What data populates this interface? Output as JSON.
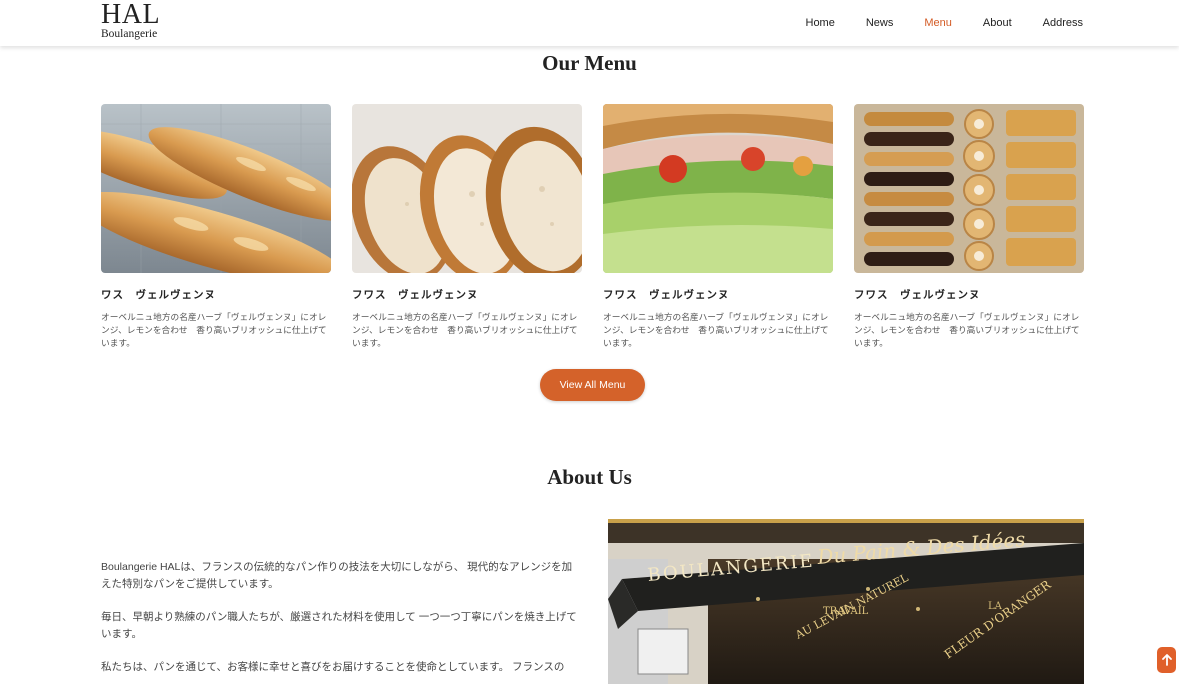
{
  "header": {
    "logo_main": "HAL",
    "logo_sub": "Boulangerie",
    "nav": [
      {
        "label": "Home"
      },
      {
        "label": "News"
      },
      {
        "label": "Menu"
      },
      {
        "label": "About"
      },
      {
        "label": "Address"
      }
    ],
    "active_nav": "Menu"
  },
  "menu": {
    "title": "Our Menu",
    "items": [
      {
        "name": "ワス　ヴェルヴェンヌ",
        "description": "オーベルニュ地方の名産ハーブ「ヴェルヴェンヌ」にオレンジ、レモンを合わせ　香り高いブリオッシュに仕上げています。",
        "image": "baguettes"
      },
      {
        "name": "フワス　ヴェルヴェンヌ",
        "description": "オーベルニュ地方の名産ハーブ「ヴェルヴェンヌ」にオレンジ、レモンを合わせ　香り高いブリオッシュに仕上げています。",
        "image": "sliced-bread"
      },
      {
        "name": "フワス　ヴェルヴェンヌ",
        "description": "オーベルニュ地方の名産ハーブ「ヴェルヴェンヌ」にオレンジ、レモンを合わせ　香り高いブリオッシュに仕上げています。",
        "image": "sandwich"
      },
      {
        "name": "フワス　ヴェルヴェンヌ",
        "description": "オーベルニュ地方の名産ハーブ「ヴェルヴェンヌ」にオレンジ、レモンを合わせ　香り高いブリオッシュに仕上げています。",
        "image": "pastries"
      }
    ],
    "button_label": "View All Menu"
  },
  "about": {
    "title": "About Us",
    "paragraphs": [
      "Boulangerie HALは、フランスの伝統的なパン作りの技法を大切にしながら、 現代的なアレンジを加えた特別なパンをご提供しています。",
      "毎日、早朝より熟練のパン職人たちが、厳選された材料を使用して 一つ一つ丁寧にパンを焼き上げています。",
      "私たちは、パンを通じて、お客様に幸せと喜びをお届けすることを使命としています。 フランスの"
    ],
    "image_signs": {
      "main": "BOULANGERIE",
      "script": "Du Pain & Des Idées",
      "left": "TRAVAIL",
      "lower_left": "AU LEVAIN NATUREL",
      "right": "FLEUR D'ORANGER",
      "corner": "LA"
    }
  },
  "colors": {
    "accent": "#d4622a",
    "text": "#222222"
  },
  "icons": {
    "scroll_top": "arrow-up-icon"
  }
}
